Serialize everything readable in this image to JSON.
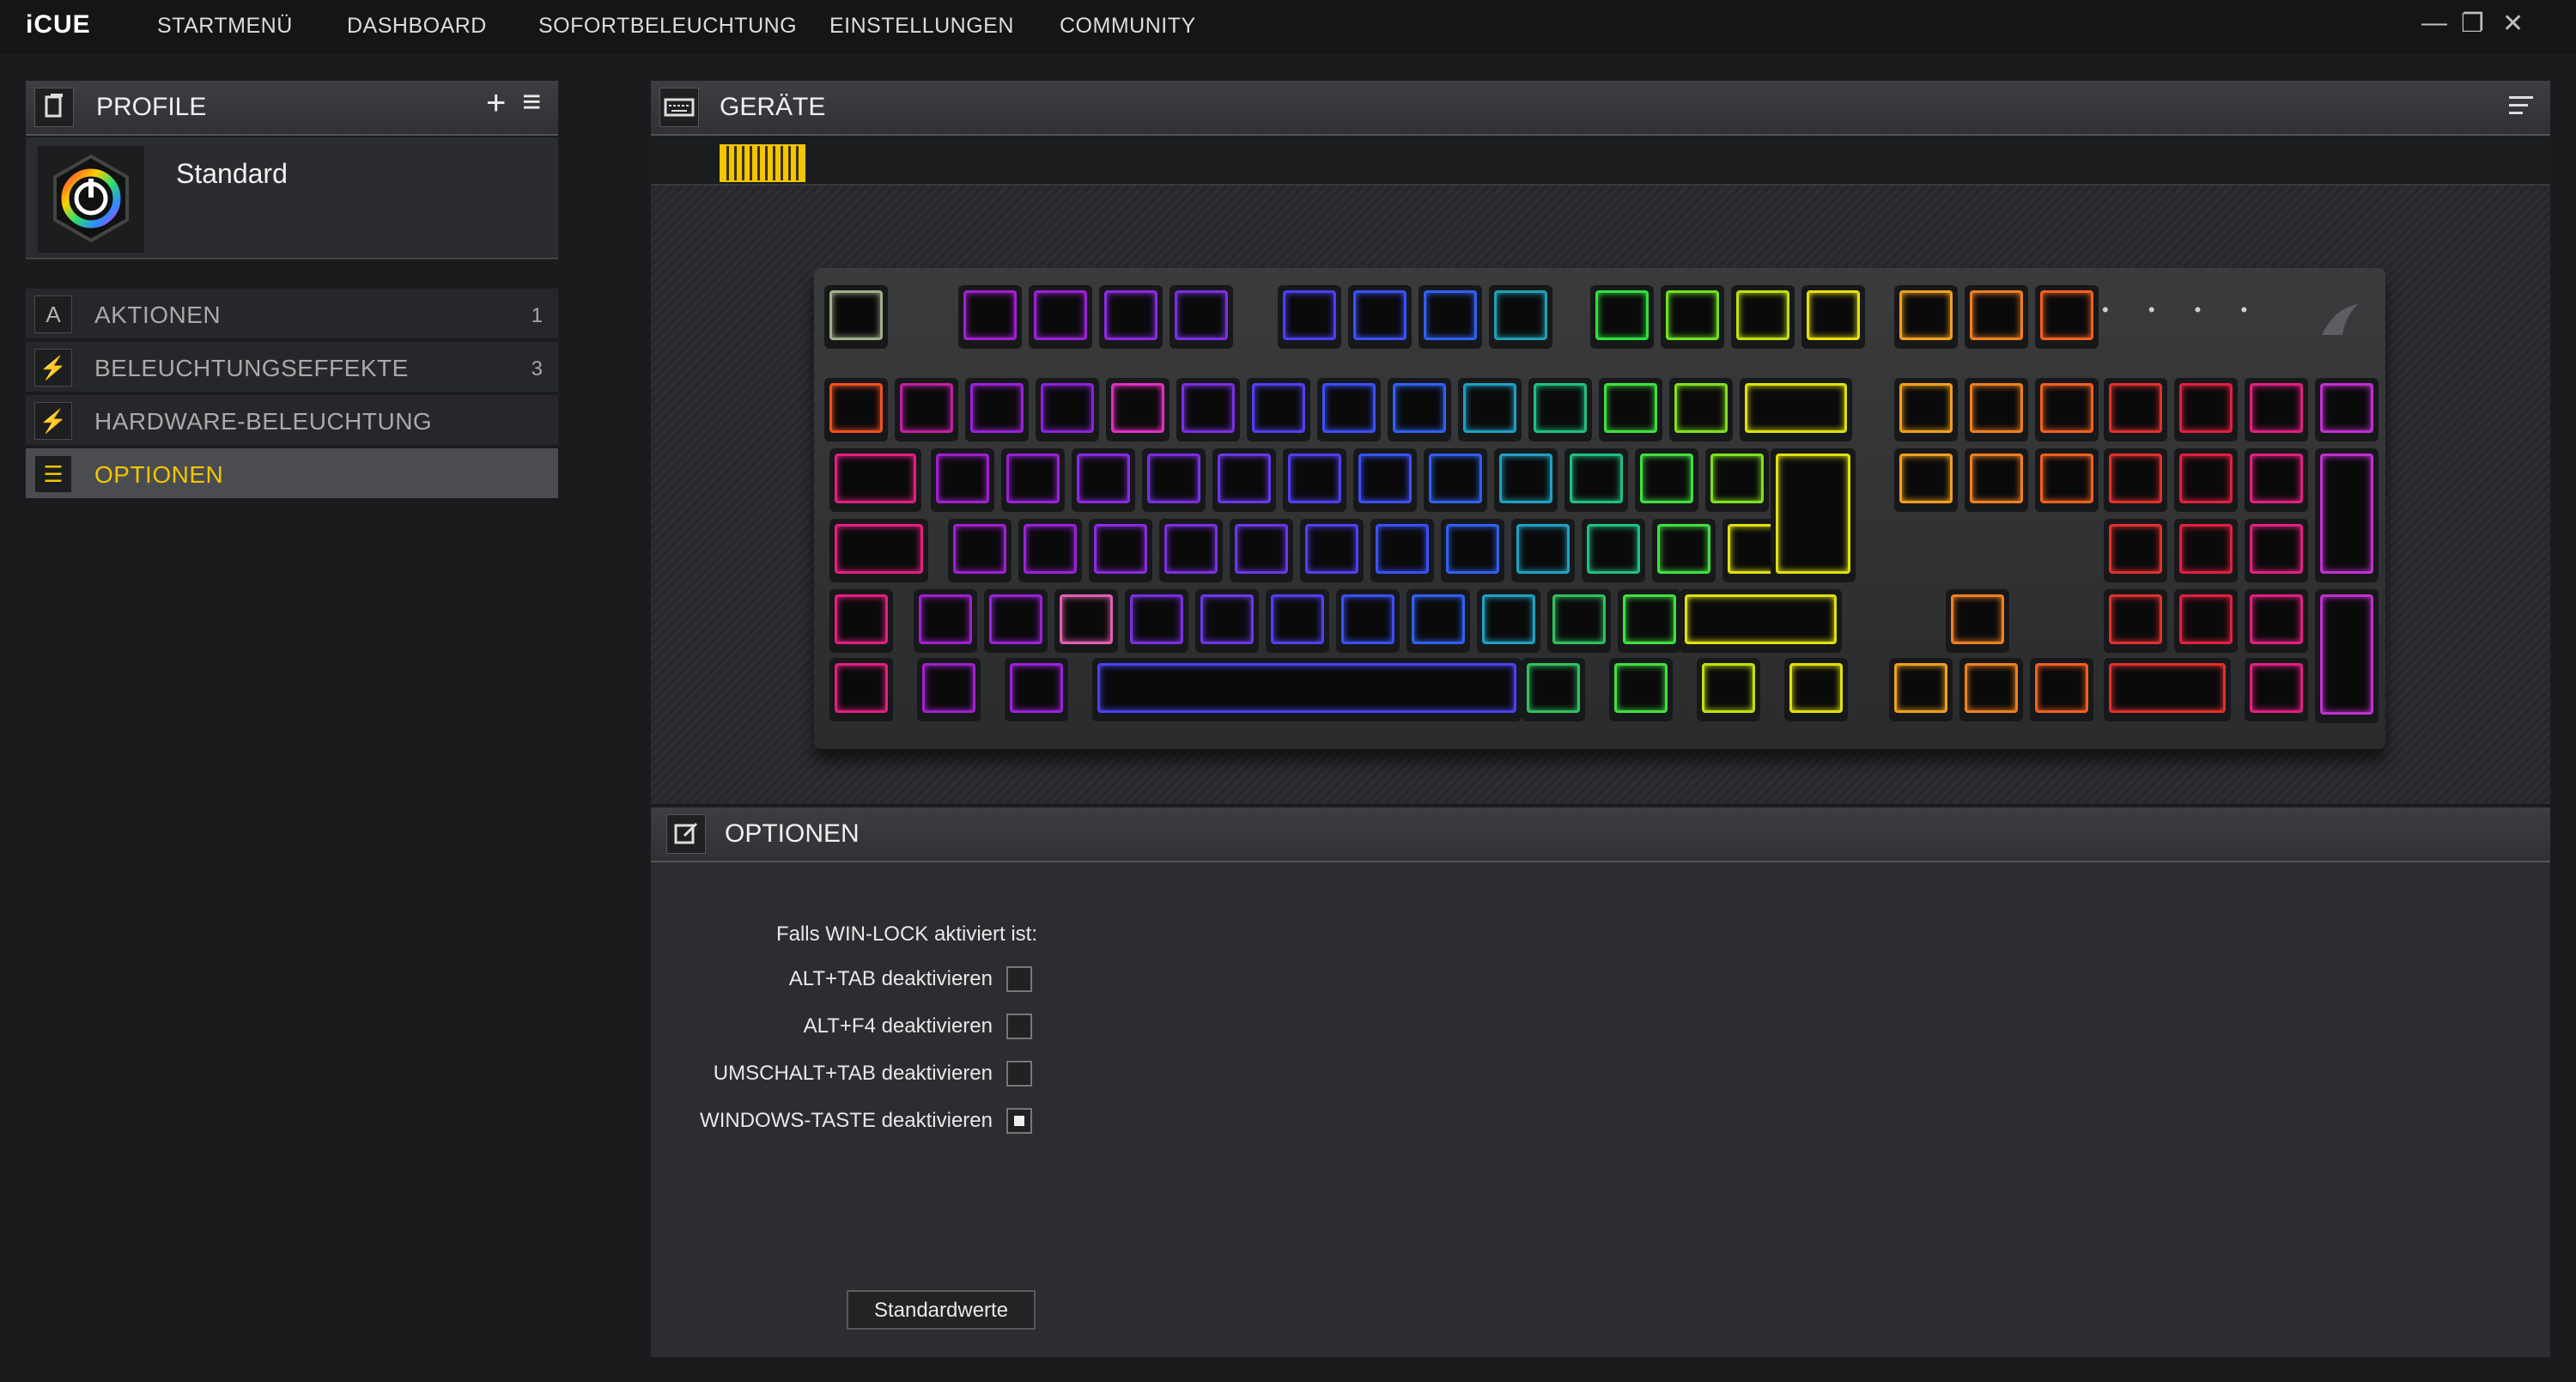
{
  "app": {
    "brand": "iCUE"
  },
  "nav": {
    "items": [
      "STARTMENÜ",
      "DASHBOARD",
      "SOFORTBELEUCHTUNG",
      "EINSTELLUNGEN",
      "COMMUNITY"
    ]
  },
  "window_controls": {
    "minimize": "—",
    "restore": "❐",
    "close": "✕"
  },
  "profiles": {
    "title": "PROFILE",
    "add_icon": "+",
    "menu_icon": "≡",
    "active_profile": "Standard"
  },
  "sidebar": {
    "items": [
      {
        "label": "AKTIONEN",
        "count": "1",
        "icon": "A"
      },
      {
        "label": "BELEUCHTUNGSEFFEKTE",
        "count": "3",
        "icon": "⚡"
      },
      {
        "label": "HARDWARE-BELEUCHTUNG",
        "count": "",
        "icon": "⚡"
      },
      {
        "label": "OPTIONEN",
        "count": "",
        "icon": "☰"
      }
    ]
  },
  "devices": {
    "title": "GERÄTE"
  },
  "options": {
    "title": "OPTIONEN",
    "heading": "Falls WIN-LOCK aktiviert ist:",
    "rows": [
      {
        "label": "ALT+TAB deaktivieren",
        "checked": false
      },
      {
        "label": "ALT+F4 deaktivieren",
        "checked": false
      },
      {
        "label": "UMSCHALT+TAB deaktivieren",
        "checked": false
      },
      {
        "label": "WINDOWS-TASTE deaktivieren",
        "checked": true
      }
    ],
    "reset_button": "Standardwerte"
  },
  "colors": {
    "accent": "#f2c500",
    "background": "#191b1d"
  }
}
